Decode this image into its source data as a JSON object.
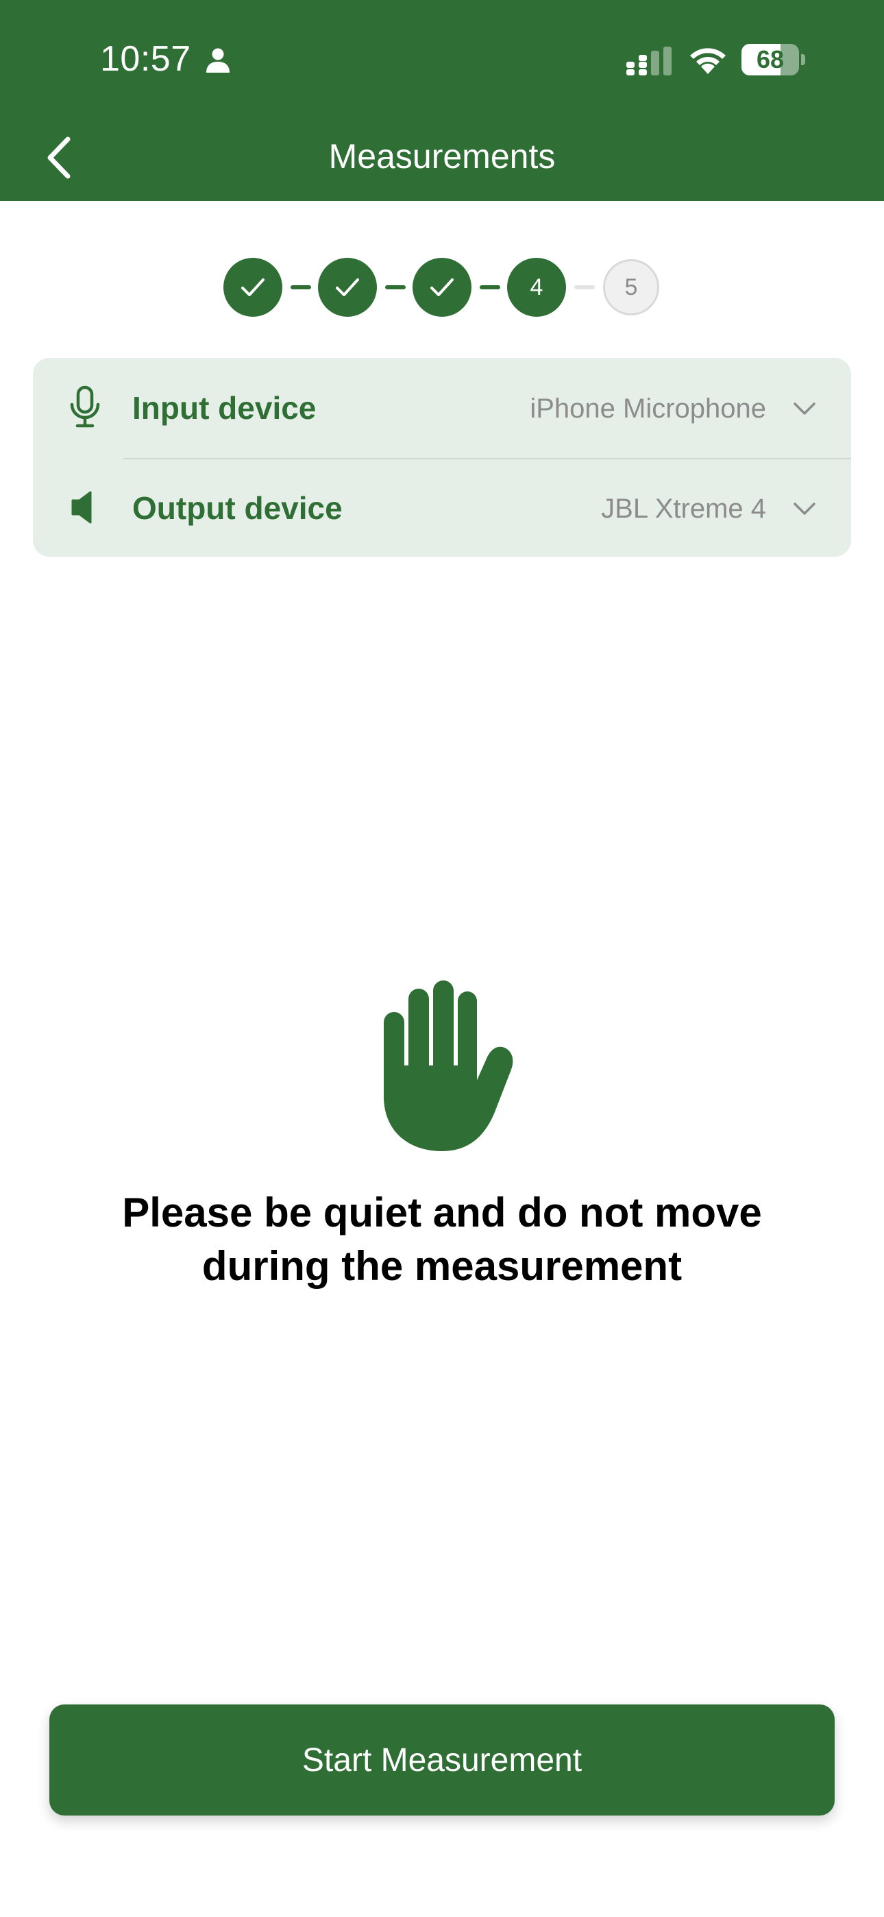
{
  "status_bar": {
    "time": "10:57",
    "battery_level": "68",
    "battery_fraction": 0.68,
    "signal_icon": "cellular-signal-icon",
    "wifi_icon": "wifi-icon",
    "person_icon": "person-icon"
  },
  "nav": {
    "title": "Measurements",
    "back_icon": "chevron-left-icon"
  },
  "stepper": {
    "steps": [
      {
        "state": "done",
        "label": "✓"
      },
      {
        "state": "done",
        "label": "✓"
      },
      {
        "state": "done",
        "label": "✓"
      },
      {
        "state": "current",
        "label": "4"
      },
      {
        "state": "future",
        "label": "5"
      }
    ]
  },
  "devices": {
    "input": {
      "label": "Input device",
      "value": "iPhone Microphone",
      "icon": "microphone-icon"
    },
    "output": {
      "label": "Output device",
      "value": "JBL Xtreme 4",
      "icon": "speaker-icon"
    }
  },
  "main": {
    "icon": "raised-hand-icon",
    "instruction_line1": "Please be quiet and do not move",
    "instruction_line2": "during the measurement"
  },
  "actions": {
    "start_label": "Start Measurement"
  },
  "colors": {
    "brand": "#2f6e34",
    "card_bg": "#e5efe7",
    "muted_text": "#8c8c8c"
  }
}
